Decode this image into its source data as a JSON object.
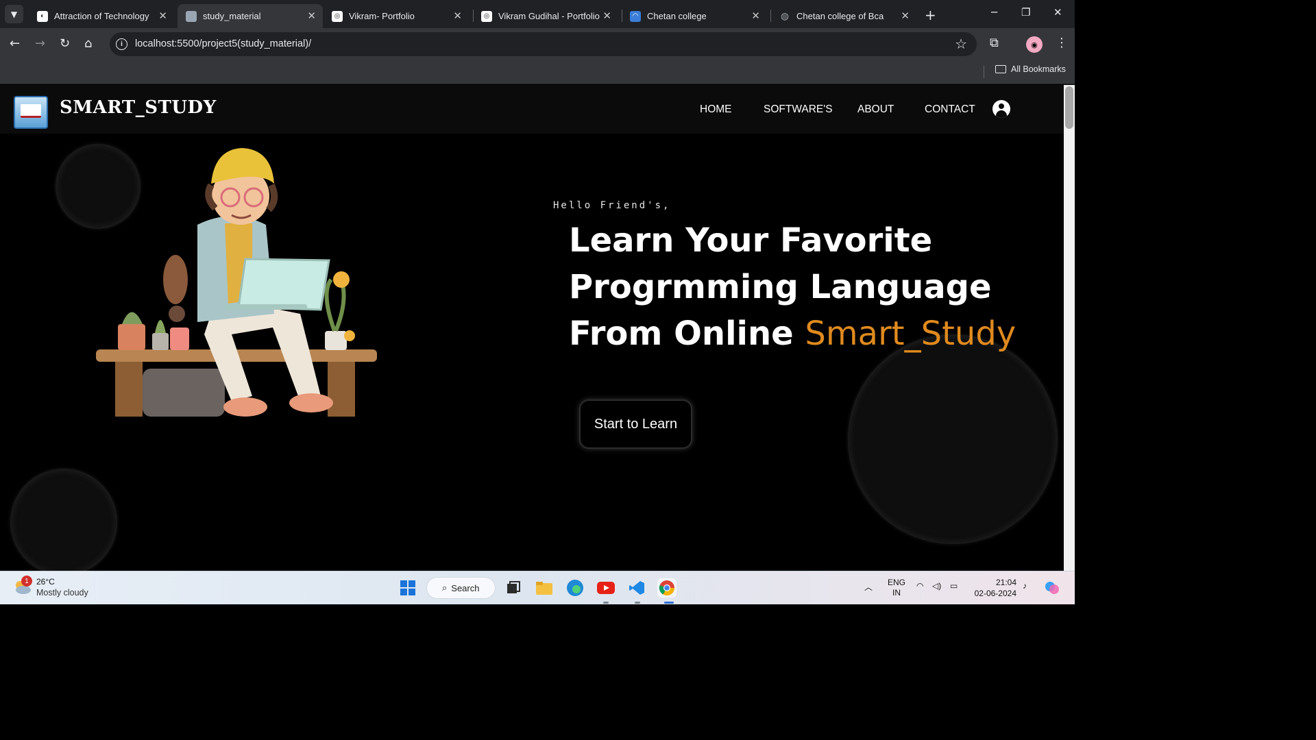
{
  "browser": {
    "tabs": [
      {
        "title": "Attraction of Technology",
        "active": false
      },
      {
        "title": "study_material",
        "active": true
      },
      {
        "title": "Vikram- Portfolio",
        "active": false
      },
      {
        "title": "Vikram Gudihal - Portfolio",
        "active": false
      },
      {
        "title": "Chetan college",
        "active": false
      },
      {
        "title": "Chetan college of Bca",
        "active": false
      }
    ],
    "url": "localhost:5500/project5(study_material)/",
    "bookmarks_label": "All Bookmarks"
  },
  "site": {
    "brand": "SMART_STUDY",
    "nav": [
      "HOME",
      "SOFTWARE'S",
      "ABOUT",
      "CONTACT"
    ],
    "hero": {
      "greeting": "Hello Friend's,",
      "line1": "Learn Your Favorite",
      "line2": "Progrmming Language",
      "line3_prefix": "From Online",
      "line3_accent": "Smart_Study",
      "cta": "Start to Learn"
    },
    "colors": {
      "accent": "#e08a1e",
      "background": "#000000",
      "navbar": "#0b0b0b"
    }
  },
  "taskbar": {
    "weather_temp": "26°C",
    "weather_desc": "Mostly cloudy",
    "weather_badge": "1",
    "search_label": "Search",
    "lang_top": "ENG",
    "lang_bottom": "IN",
    "time": "21:04",
    "date": "02-06-2024"
  }
}
